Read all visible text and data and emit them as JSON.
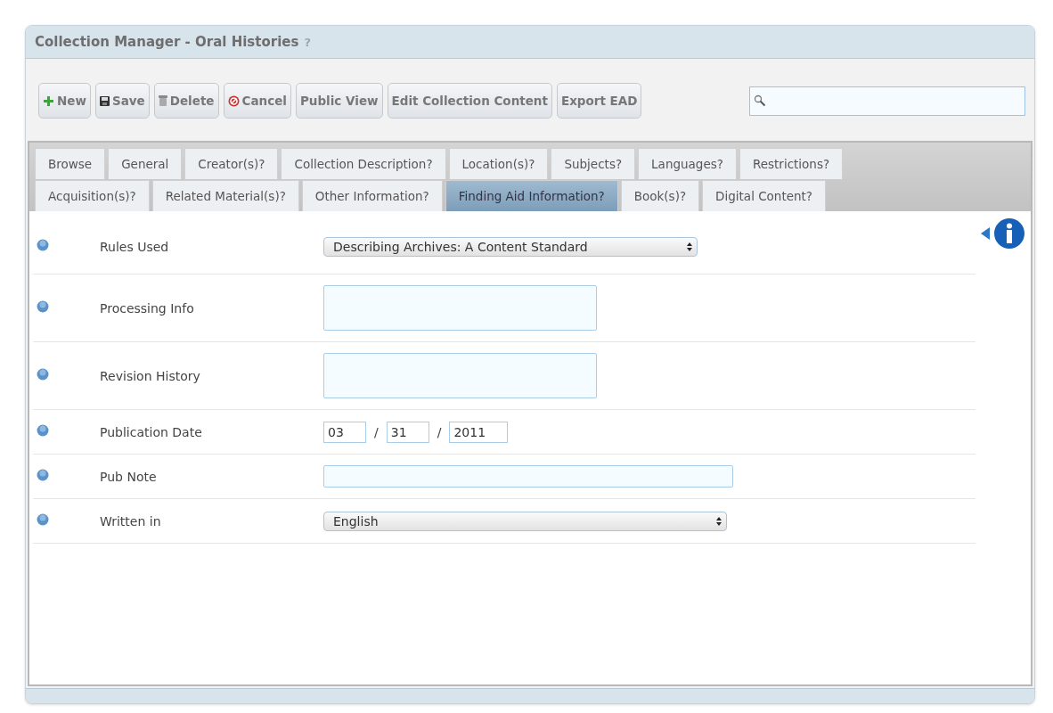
{
  "window": {
    "title": "Collection Manager - Oral Histories",
    "help_mark": "?"
  },
  "toolbar": {
    "buttons": [
      {
        "label": "New"
      },
      {
        "label": "Save"
      },
      {
        "label": "Delete"
      },
      {
        "label": "Cancel"
      },
      {
        "label": "Public View"
      },
      {
        "label": "Edit Collection Content"
      },
      {
        "label": "Export EAD"
      }
    ]
  },
  "tab_rows": [
    [
      {
        "label": "Browse",
        "selected": false
      },
      {
        "label": "General",
        "selected": false
      },
      {
        "label": "Creator(s)?",
        "selected": false
      },
      {
        "label": "Collection Description?",
        "selected": false
      },
      {
        "label": "Location(s)?",
        "selected": false
      },
      {
        "label": "Subjects?",
        "selected": false
      },
      {
        "label": "Languages?",
        "selected": false
      },
      {
        "label": "Restrictions?",
        "selected": false
      }
    ],
    [
      {
        "label": "Acquisition(s)?",
        "selected": false
      },
      {
        "label": "Related Material(s)?",
        "selected": false
      },
      {
        "label": "Other Information?",
        "selected": false
      },
      {
        "label": "Finding Aid Information?",
        "selected": true
      },
      {
        "label": "Book(s)?",
        "selected": false
      },
      {
        "label": "Digital Content?",
        "selected": false
      }
    ]
  ],
  "fields": [
    {
      "label": "Rules Used",
      "kind": "select",
      "value": "Describing Archives: A Content Standard"
    },
    {
      "label": "Processing Info",
      "kind": "textarea"
    },
    {
      "label": "Revision History",
      "kind": "textarea"
    },
    {
      "label": "Publication Date",
      "kind": "date",
      "parts": [
        "03",
        "31",
        "2011"
      ],
      "separators": [
        "/",
        "/"
      ]
    },
    {
      "label": "Pub Note",
      "kind": "text"
    },
    {
      "label": "Written in",
      "kind": "select",
      "value": "English"
    }
  ]
}
